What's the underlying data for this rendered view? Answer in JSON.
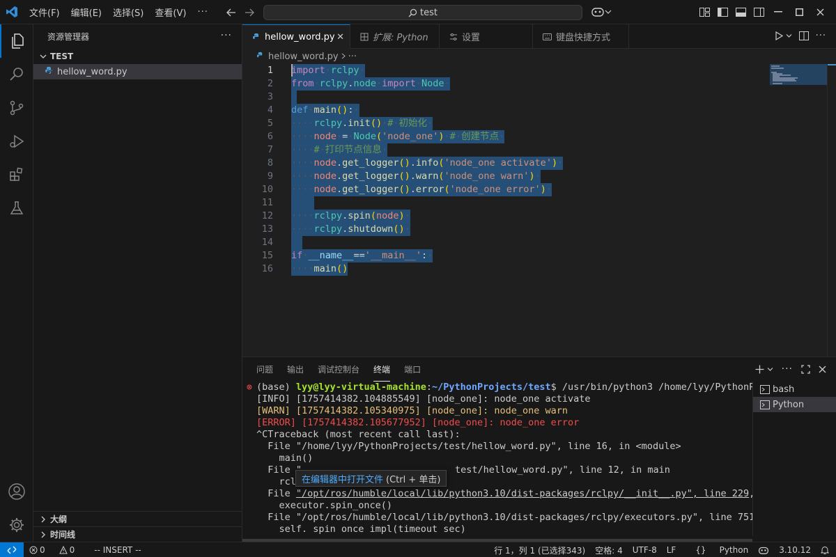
{
  "titlebar": {
    "menu": [
      "文件(F)",
      "编辑(E)",
      "选择(S)",
      "查看(V)"
    ],
    "more": "···",
    "search_text": "test"
  },
  "sidebar": {
    "title": "资源管理器",
    "folder": "TEST",
    "file": "hellow_word.py",
    "outline": "大纲",
    "timeline": "时间线"
  },
  "tabs": [
    {
      "label": "hellow_word.py"
    },
    {
      "label": "扩展: Python"
    },
    {
      "label": "设置"
    },
    {
      "label": "键盘快捷方式"
    }
  ],
  "breadcrumb": {
    "file": "hellow_word.py",
    "more": "···"
  },
  "editor": {
    "line_numbers": [
      "1",
      "2",
      "3",
      "4",
      "5",
      "6",
      "7",
      "8",
      "9",
      "10",
      "11",
      "12",
      "13",
      "14",
      "15",
      "16"
    ]
  },
  "panel": {
    "tabs": [
      "问题",
      "输出",
      "调试控制台",
      "终端",
      "端口"
    ],
    "terminals": [
      "bash",
      "Python"
    ],
    "tooltip_link": "在编辑器中打开文件",
    "tooltip_hint": "(Ctrl + 单击)",
    "lines": {
      "l1_base": "(base) ",
      "l1_user": "lyy@lyy-virtual-machine",
      "l1_colon": ":",
      "l1_path": "~/PythonProjects/test",
      "l1_cmd": "$ /usr/bin/python3 /home/lyy/PythonPr",
      "l2": "[INFO] [1757414382.104885549] [node_one]: node_one activate",
      "l3": "[WARN] [1757414382.105340975] [node_one]: node_one warn",
      "l4": "[ERROR] [1757414382.105677952] [node_one]: node_one error",
      "l5": "^CTraceback (most recent call last):",
      "l6": "  File \"/home/lyy/PythonProjects/test/hellow_word.py\", line 16, in <module>",
      "l7": "    main()",
      "l8a": "  File \"",
      "l8b": "test/hellow_word.py\", line 12, in main",
      "l9": "    rcl",
      "l10a": "  File ",
      "l10link": "\"/opt/ros/humble/local/lib/python3.10/dist-packages/rclpy/__init__.py\", line 229",
      "l10b": ",",
      "l11": "    executor.spin_once()",
      "l12": "  File \"/opt/ros/humble/local/lib/python3.10/dist-packages/rclpy/executors.py\", line 751,",
      "l13": "    self. spin once impl(timeout sec)"
    }
  },
  "statusbar": {
    "errors": "0",
    "warnings": "0",
    "mode": "-- INSERT --",
    "position": "行 1，列 1 (已选择343)",
    "spaces": "空格: 4",
    "encoding": "UTF-8",
    "eol": "LF",
    "language": "Python",
    "version": "3.10.12"
  },
  "colors": {
    "accent": "#0078d4",
    "selection": "#264f78",
    "error": "#f14c4c"
  }
}
